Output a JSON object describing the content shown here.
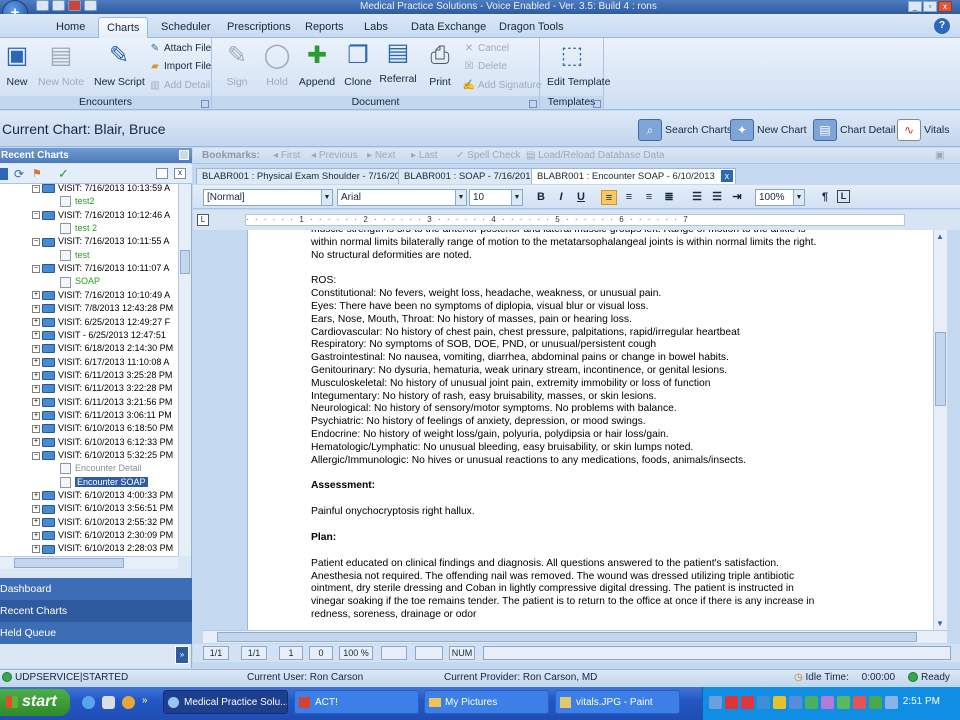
{
  "titlebar": {
    "title": "Medical Practice Solutions - Voice Enabled - Ver. 3.5: Build 4 : rons"
  },
  "tabs": [
    "Home",
    "Charts",
    "Scheduler",
    "Prescriptions",
    "Reports",
    "Labs",
    "Data Exchange",
    "Dragon Tools"
  ],
  "ribbon": {
    "encounters": {
      "label": "Encounters",
      "new": "New",
      "new_note": "New Note",
      "new_script": "New Script",
      "attach_file": "Attach File",
      "import_file": "Import File",
      "add_detail": "Add Detail"
    },
    "document": {
      "label": "Document",
      "sign": "Sign",
      "hold": "Hold",
      "append": "Append",
      "clone": "Clone",
      "referral": "Referral",
      "print": "Print",
      "cancel": "Cancel",
      "delete": "Delete",
      "add_signature": "Add Signature"
    },
    "templates": {
      "label": "Templates",
      "edit_template": "Edit Template"
    }
  },
  "chart": {
    "label": "Current Chart:",
    "patient": "Blair, Bruce",
    "buttons": [
      "Search Charts",
      "New Chart",
      "Chart Detail",
      "Vitals"
    ]
  },
  "left_panel": {
    "title": "Recent Charts",
    "tree": [
      {
        "text": "VISIT: 7/16/2013 10:13:59 A",
        "kind": "visit",
        "expanded": true
      },
      {
        "text": "test2",
        "kind": "note"
      },
      {
        "text": "VISIT: 7/16/2013 10:12:46 A",
        "kind": "visit",
        "expanded": true
      },
      {
        "text": "test 2",
        "kind": "note"
      },
      {
        "text": "VISIT: 7/16/2013 10:11:55 A",
        "kind": "visit",
        "expanded": true
      },
      {
        "text": "test",
        "kind": "note"
      },
      {
        "text": "VISIT: 7/16/2013 10:11:07 A",
        "kind": "visit",
        "expanded": true
      },
      {
        "text": "SOAP",
        "kind": "note"
      },
      {
        "text": "VISIT: 7/16/2013 10:10:49 A",
        "kind": "visit",
        "expanded": false
      },
      {
        "text": "VISIT: 7/8/2013 12:43:28 PM",
        "kind": "visit",
        "expanded": false
      },
      {
        "text": "VISIT: 6/25/2013 12:49:27 F",
        "kind": "visit",
        "expanded": false
      },
      {
        "text": "VISIT - 6/25/2013 12:47:51",
        "kind": "visit",
        "expanded": false
      },
      {
        "text": "VISIT: 6/18/2013 2:14:30 PM",
        "kind": "visit",
        "expanded": false
      },
      {
        "text": "VISIT: 6/17/2013 11:10:08 A",
        "kind": "visit",
        "expanded": false
      },
      {
        "text": "VISIT: 6/11/2013 3:25:28 PM",
        "kind": "visit",
        "expanded": false
      },
      {
        "text": "VISIT: 6/11/2013 3:22:28 PM",
        "kind": "visit",
        "expanded": false
      },
      {
        "text": "VISIT: 6/11/2013 3:21:56 PM",
        "kind": "visit",
        "expanded": false
      },
      {
        "text": "VISIT: 6/11/2013 3:06:11 PM",
        "kind": "visit",
        "expanded": false
      },
      {
        "text": "VISIT: 6/10/2013 6:18:50 PM",
        "kind": "visit",
        "expanded": false
      },
      {
        "text": "VISIT: 6/10/2013 6:12:33 PM",
        "kind": "visit",
        "expanded": false
      },
      {
        "text": "VISIT: 6/10/2013 5:32:25 PM",
        "kind": "visit",
        "expanded": true
      },
      {
        "text": "Encounter Detail",
        "kind": "detail"
      },
      {
        "text": "Encounter SOAP",
        "kind": "selected"
      },
      {
        "text": "VISIT: 6/10/2013 4:00:33 PM",
        "kind": "visit",
        "expanded": false
      },
      {
        "text": "VISIT: 6/10/2013 3:56:51 PM",
        "kind": "visit",
        "expanded": false
      },
      {
        "text": "VISIT: 6/10/2013 2:55:32 PM",
        "kind": "visit",
        "expanded": false
      },
      {
        "text": "VISIT: 6/10/2013 2:30:09 PM",
        "kind": "visit",
        "expanded": false
      },
      {
        "text": "VISIT: 6/10/2013 2:28:03 PM",
        "kind": "visit",
        "expanded": false
      }
    ],
    "nav": [
      "Dashboard",
      "Recent Charts",
      "Held Queue"
    ]
  },
  "bookmarks": {
    "label": "Bookmarks:",
    "items": [
      "First",
      "Previous",
      "Next",
      "Last",
      "Spell Check",
      "Load/Reload Database Data"
    ]
  },
  "doc_tabs": [
    "BLABR001 : Physical Exam Shoulder - 7/16/2013",
    "BLABR001 : SOAP - 7/16/2013",
    "BLABR001 : Encounter SOAP - 6/10/2013"
  ],
  "format": {
    "style": "[Normal]",
    "font": "Arial",
    "size": "10",
    "zoom": "100%"
  },
  "document_lines": [
    "muscle strength is 5/5 to the anterior posterior and lateral muscle groups left.  Range of motion to the ankle is",
    "within normal limits bilaterally range of motion to the metatarsophalangeal joints is within normal limits the right.",
    "No structural deformities are noted.",
    "",
    "ROS:",
    "Constitutional:  No fevers, weight loss, headache, weakness, or unusual pain.",
    "Eyes:  There have been no symptoms of diplopia, visual blur or visual loss.",
    "Ears, Nose, Mouth, Throat:  No history of masses, pain or hearing loss.",
    "Cardiovascular:  No history of chest pain, chest pressure, palpitations, rapid/irregular heartbeat",
    "Respiratory:  No symptoms of SOB, DOE, PND, or unusual/persistent cough",
    "Gastrointestinal:   No nausea, vomiting, diarrhea, abdominal pains or change in bowel habits.",
    "Genitourinary:  No dysuria, hematuria, weak urinary stream, incontinence, or genital lesions.",
    "Musculoskeletal:  No history of unusual joint pain, extremity immobility or loss of function",
    "Integumentary:  No history of rash, easy bruisability, masses, or skin lesions.",
    "Neurological:  No history of sensory/motor symptoms.  No problems with balance.",
    "Psychiatric:  No history of feelings of anxiety, depression, or mood swings.",
    "Endocrine:  No history of weight loss/gain, polyuria, polydipsia or hair loss/gain.",
    "Hematologic/Lymphatic:  No unusual bleeding, easy bruisability, or skin lumps noted.",
    "Allergic/Immunologic:  No hives or unusual reactions to any medications, foods, animals/insects.",
    "",
    "Assessment:",
    "",
    "Painful onychocryptosis right hallux.",
    "",
    "Plan:",
    "",
    "Patient educated on clinical findings and diagnosis.  All questions answered to the patient's satisfaction.",
    "Anesthesia not required.  The offending nail was removed.  The wound was dressed utilizing triple antibiotic",
    "ointment, dry sterile dressing and Coban in lightly compressive digital dressing.  The patient is instructed in",
    "vinegar soaking if the toe remains tender.  The patient is to return to the office at once if there is any increase in",
    "redness, soreness, drainage or odor"
  ],
  "doc_status": [
    "1/1",
    "1/1",
    "1",
    "0",
    "100 %",
    "",
    "",
    "NUM"
  ],
  "statusbar": {
    "service": "UDPSERVICE|STARTED",
    "current_user": "Current User:  Ron Carson",
    "current_provider": "Current Provider:  Ron Carson, MD",
    "idle_label": "Idle Time:",
    "idle_value": "0:00:00",
    "ready": "Ready"
  },
  "taskbar": {
    "start": "start",
    "tasks": [
      "Medical Practice Solu...",
      "ACT!",
      "My Pictures",
      "vitals.JPG - Paint"
    ],
    "clock": "2:51 PM"
  }
}
